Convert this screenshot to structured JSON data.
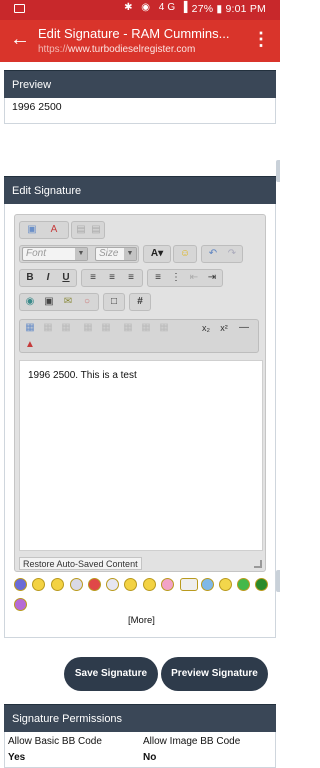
{
  "status_bar": {
    "time": "27% ▮ 9:01 PM",
    "icons": "✱ ◉ 4G ▌"
  },
  "app_bar": {
    "title": "Edit Signature - RAM Cummins...",
    "url_scheme": "https://",
    "url_host": "www.turbodieselregister.com",
    "back_icon": "arrow-left-icon",
    "menu_icon": "overflow-menu-icon"
  },
  "preview": {
    "heading": "Preview",
    "text": "1996 2500"
  },
  "edit_signature": {
    "heading": "Edit Signature",
    "font_select": "Font",
    "size_select": "Size",
    "editor_text": "1996 2500. This is a test",
    "restore_label": "Restore Auto-Saved Content",
    "more_label": "[More]"
  },
  "buttons": {
    "save": "Save Signature",
    "preview": "Preview Signature"
  },
  "permissions": {
    "heading": "Signature Permissions",
    "items": [
      {
        "label": "Allow Basic BB Code",
        "value": "Yes"
      },
      {
        "label": "Allow Image BB Code",
        "value": "No"
      }
    ]
  },
  "colors": {
    "status_bar": "#c8282b",
    "app_bar": "#d9342b",
    "panel_header": "#3a4757",
    "button_pill": "#2e3b4b"
  }
}
